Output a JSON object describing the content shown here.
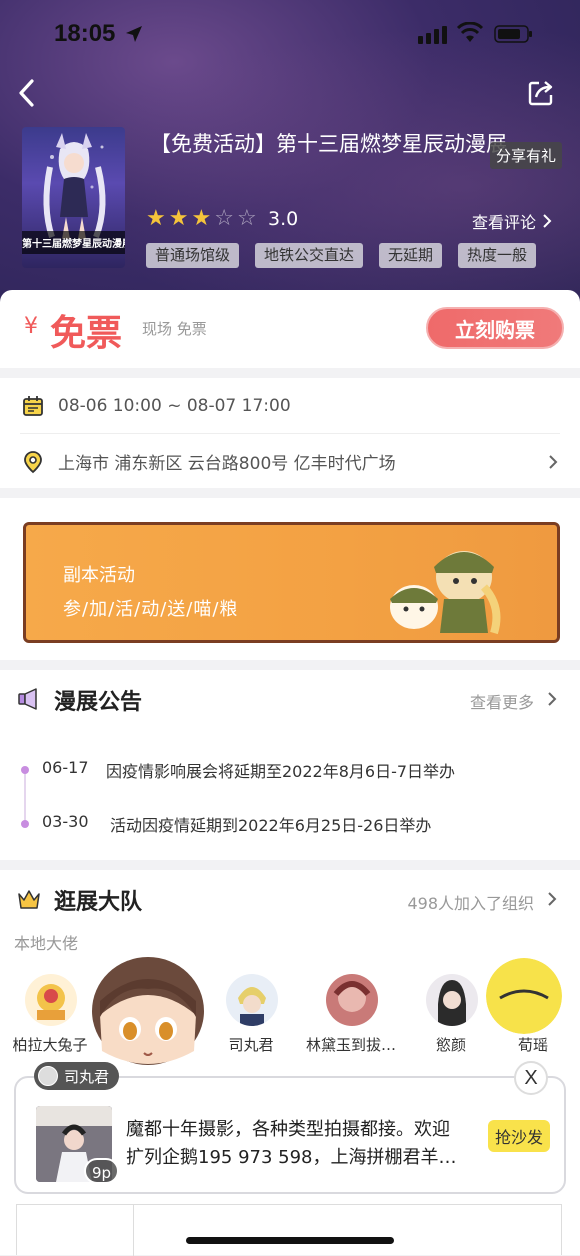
{
  "status_bar": {
    "time": "18:05"
  },
  "header": {
    "title": "【免费活动】第十三届燃梦星辰动漫展",
    "share_tip": "分享有礼",
    "poster_caption": "第十三届燃梦星辰动漫展",
    "rating": "3.0",
    "stars": [
      true,
      true,
      true,
      false,
      false
    ],
    "review_link": "查看评论",
    "tags": [
      "普通场馆级",
      "地铁公交直达",
      "无延期",
      "热度一般"
    ]
  },
  "price": {
    "currency": "¥",
    "label": "免票",
    "note": "现场 免票",
    "buy_button": "立刻购票"
  },
  "info": {
    "date_range": "08-06 10:00 ~ 08-07 17:00",
    "address": "上海市 浦东新区 云台路800号 亿丰时代广场"
  },
  "banner": {
    "title": "副本活动",
    "subtitle": "参/加/活/动/送/喵/粮"
  },
  "notices": {
    "title": "漫展公告",
    "more": "查看更多",
    "items": [
      {
        "date": "06-17",
        "text": "因疫情影响展会将延期至2022年8月6日-7日举办"
      },
      {
        "date": "03-30",
        "text": "活动因疫情延期到2022年6月25日-26日举办"
      }
    ]
  },
  "team": {
    "title": "逛展大队",
    "count": "498人加入了组织",
    "subtitle": "本地大佬",
    "members": [
      {
        "name": "柏拉大兔子"
      },
      {
        "name": ""
      },
      {
        "name": "司丸君"
      },
      {
        "name": "林黛玉到拔…"
      },
      {
        "name": "慾颜"
      },
      {
        "name": "荀瑶"
      }
    ]
  },
  "popup": {
    "author": "司丸君",
    "close": "X",
    "photo_count": "9p",
    "text_lines": [
      "魔都十年摄影，各种类型拍摄都接。欢迎",
      "扩列企鹅195 973 598，上海拼棚君羊…"
    ],
    "sofa_button": "抢沙发"
  },
  "colors": {
    "accent_red": "#f05a5a",
    "banner_orange": "#f3a143",
    "timeline_purple": "#c88de0",
    "sofa_yellow": "#f9e24b"
  }
}
